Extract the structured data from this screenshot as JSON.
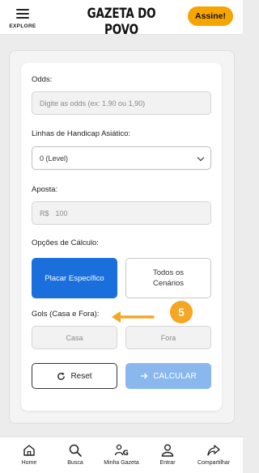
{
  "header": {
    "menu_label": "EXPLORE",
    "logo_text": "GAZETA DO POVO",
    "subscribe_label": "Assine!"
  },
  "form": {
    "odds_label": "Odds:",
    "odds_placeholder": "Digite as odds (ex: 1.90 ou 1,90)",
    "handicap_label": "Linhas de Handicap Asiático:",
    "handicap_value": "0 (Level)",
    "stake_label": "Aposta:",
    "stake_prefix": "R$",
    "stake_value": "100",
    "calc_options_label": "Opções de Cálculo:",
    "option_specific": "Placar Específico",
    "option_all": "Todos os Cenários",
    "goals_label": "Gols (Casa e Fora):",
    "home_placeholder": "Casa",
    "away_placeholder": "Fora",
    "reset_label": "Reset",
    "calculate_label": "CALCULAR"
  },
  "annotation": {
    "step_number": "5"
  },
  "bottom_nav": {
    "home": "Home",
    "search": "Busca",
    "my_gazeta": "Minha Gazeta",
    "login": "Entrar",
    "share": "Compartilhar"
  },
  "colors": {
    "brand_accent": "#f6a500",
    "primary": "#1a6fdc",
    "primary_disabled": "#8ab8ee",
    "annotation": "#f5a623"
  }
}
